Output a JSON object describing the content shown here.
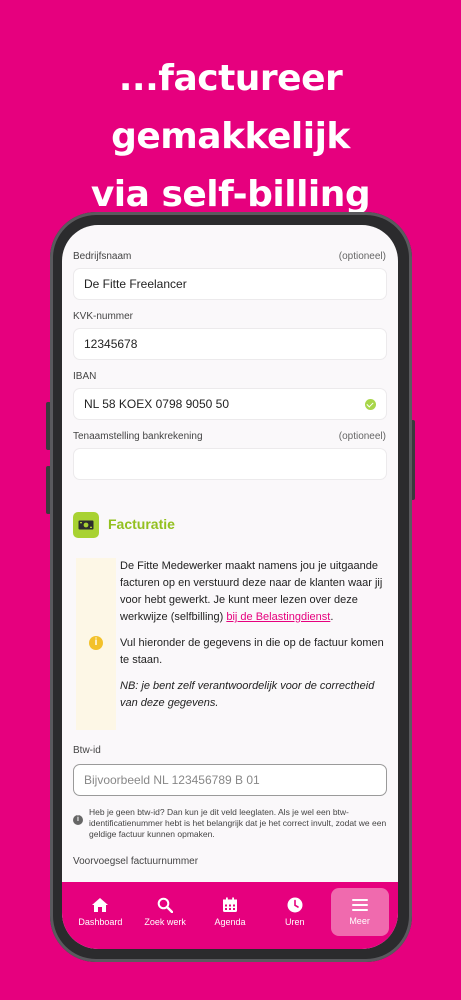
{
  "headline": {
    "line1": "...factureer gemakkelijk",
    "line2": "via self-billing"
  },
  "form": {
    "company": {
      "label": "Bedrijfsnaam",
      "optional": "(optioneel)",
      "value": "De Fitte Freelancer"
    },
    "kvk": {
      "label": "KVK-nummer",
      "value": "12345678"
    },
    "iban": {
      "label": "IBAN",
      "value": "NL 58 KOEX 0798 9050 50"
    },
    "holder": {
      "label": "Tenaamstelling bankrekening",
      "optional": "(optioneel)",
      "value": ""
    }
  },
  "section": {
    "title": "Facturatie",
    "icon": "money-icon"
  },
  "info": {
    "p1_before_link": "De Fitte Medewerker maakt namens jou je uitgaande facturen op en verstuurd deze naar de klanten waar jij voor hebt gewerkt. Je kunt meer lezen over deze werkwijze (selfbilling) ",
    "p1_link": "bij de Belastingdienst",
    "p1_after_link": ".",
    "p2": "Vul hieronder de gegevens in die op de factuur komen te staan.",
    "p3": "NB: je bent zelf verantwoordelijk voor de correctheid van deze gegevens."
  },
  "btw": {
    "label": "Btw-id",
    "placeholder": "Bijvoorbeeld NL 123456789 B 01",
    "hint": "Heb je geen btw-id? Dan kun je dit veld leeglaten. Als je wel een btw-identificatienummer hebt is het belangrijk dat je het correct invult, zodat we een geldige factuur kunnen opmaken."
  },
  "prefix": {
    "label": "Voorvoegsel factuurnummer"
  },
  "nav": {
    "items": [
      {
        "label": "Dashboard",
        "icon": "home-icon"
      },
      {
        "label": "Zoek werk",
        "icon": "search-icon"
      },
      {
        "label": "Agenda",
        "icon": "calendar-icon"
      },
      {
        "label": "Uren",
        "icon": "clock-icon"
      },
      {
        "label": "Meer",
        "icon": "menu-icon"
      }
    ],
    "active": "Meer"
  },
  "colors": {
    "brand": "#e6007e",
    "accent": "#93c01f",
    "info": "#f3c12a"
  }
}
